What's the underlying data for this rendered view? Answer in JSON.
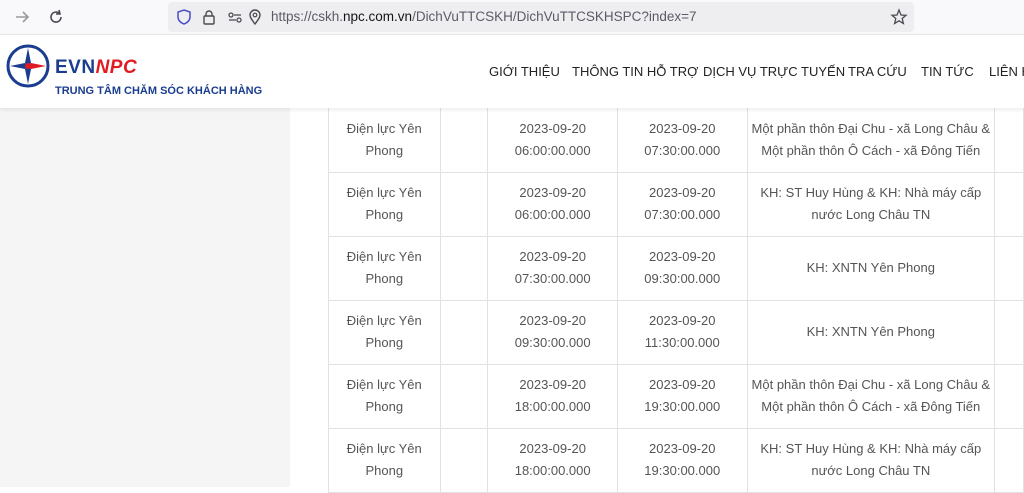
{
  "browser": {
    "url_prefix": "https://cskh.",
    "url_domain": "npc.com.vn",
    "url_path": "/DichVuTTCSKH/DichVuTTCSKHSPC?index=7"
  },
  "header": {
    "logo_evn": "EVN",
    "logo_npc": "NPC",
    "logo_subtitle": "TRUNG TÂM CHĂM SÓC KHÁCH HÀNG",
    "menu": [
      "GIỚI THIỆU",
      "THÔNG TIN HỖ TRỢ",
      "DỊCH VỤ TRỰC TUYẾN",
      "TRA CỨU",
      "TIN TỨC",
      "LIÊN H"
    ]
  },
  "table": {
    "rows": [
      {
        "unit": [
          "Điện lực Yên",
          "Phong"
        ],
        "start": [
          "2023-09-20",
          "06:00:00.000"
        ],
        "end": [
          "2023-09-20",
          "07:30:00.000"
        ],
        "area": [
          "Một phần thôn Đại Chu - xã Long Châu &",
          "Một phần thôn Ô Cách - xã Đông Tiến"
        ]
      },
      {
        "unit": [
          "Điện lực Yên",
          "Phong"
        ],
        "start": [
          "2023-09-20",
          "06:00:00.000"
        ],
        "end": [
          "2023-09-20",
          "07:30:00.000"
        ],
        "area": [
          "KH: ST Huy Hùng & KH: Nhà máy cấp",
          "nước Long Châu TN"
        ]
      },
      {
        "unit": [
          "Điện lực Yên",
          "Phong"
        ],
        "start": [
          "2023-09-20",
          "07:30:00.000"
        ],
        "end": [
          "2023-09-20",
          "09:30:00.000"
        ],
        "area": [
          "KH: XNTN Yên Phong"
        ]
      },
      {
        "unit": [
          "Điện lực Yên",
          "Phong"
        ],
        "start": [
          "2023-09-20",
          "09:30:00.000"
        ],
        "end": [
          "2023-09-20",
          "11:30:00.000"
        ],
        "area": [
          "KH: XNTN Yên Phong"
        ]
      },
      {
        "unit": [
          "Điện lực Yên",
          "Phong"
        ],
        "start": [
          "2023-09-20",
          "18:00:00.000"
        ],
        "end": [
          "2023-09-20",
          "19:30:00.000"
        ],
        "area": [
          "Một phần thôn Đại Chu - xã Long Châu &",
          "Một phần thôn Ô Cách - xã Đông Tiến"
        ]
      },
      {
        "unit": [
          "Điện lực Yên",
          "Phong"
        ],
        "start": [
          "2023-09-20",
          "18:00:00.000"
        ],
        "end": [
          "2023-09-20",
          "19:30:00.000"
        ],
        "area": [
          "KH: ST Huy Hùng & KH: Nhà máy cấp",
          "nước Long Châu TN"
        ]
      }
    ]
  }
}
